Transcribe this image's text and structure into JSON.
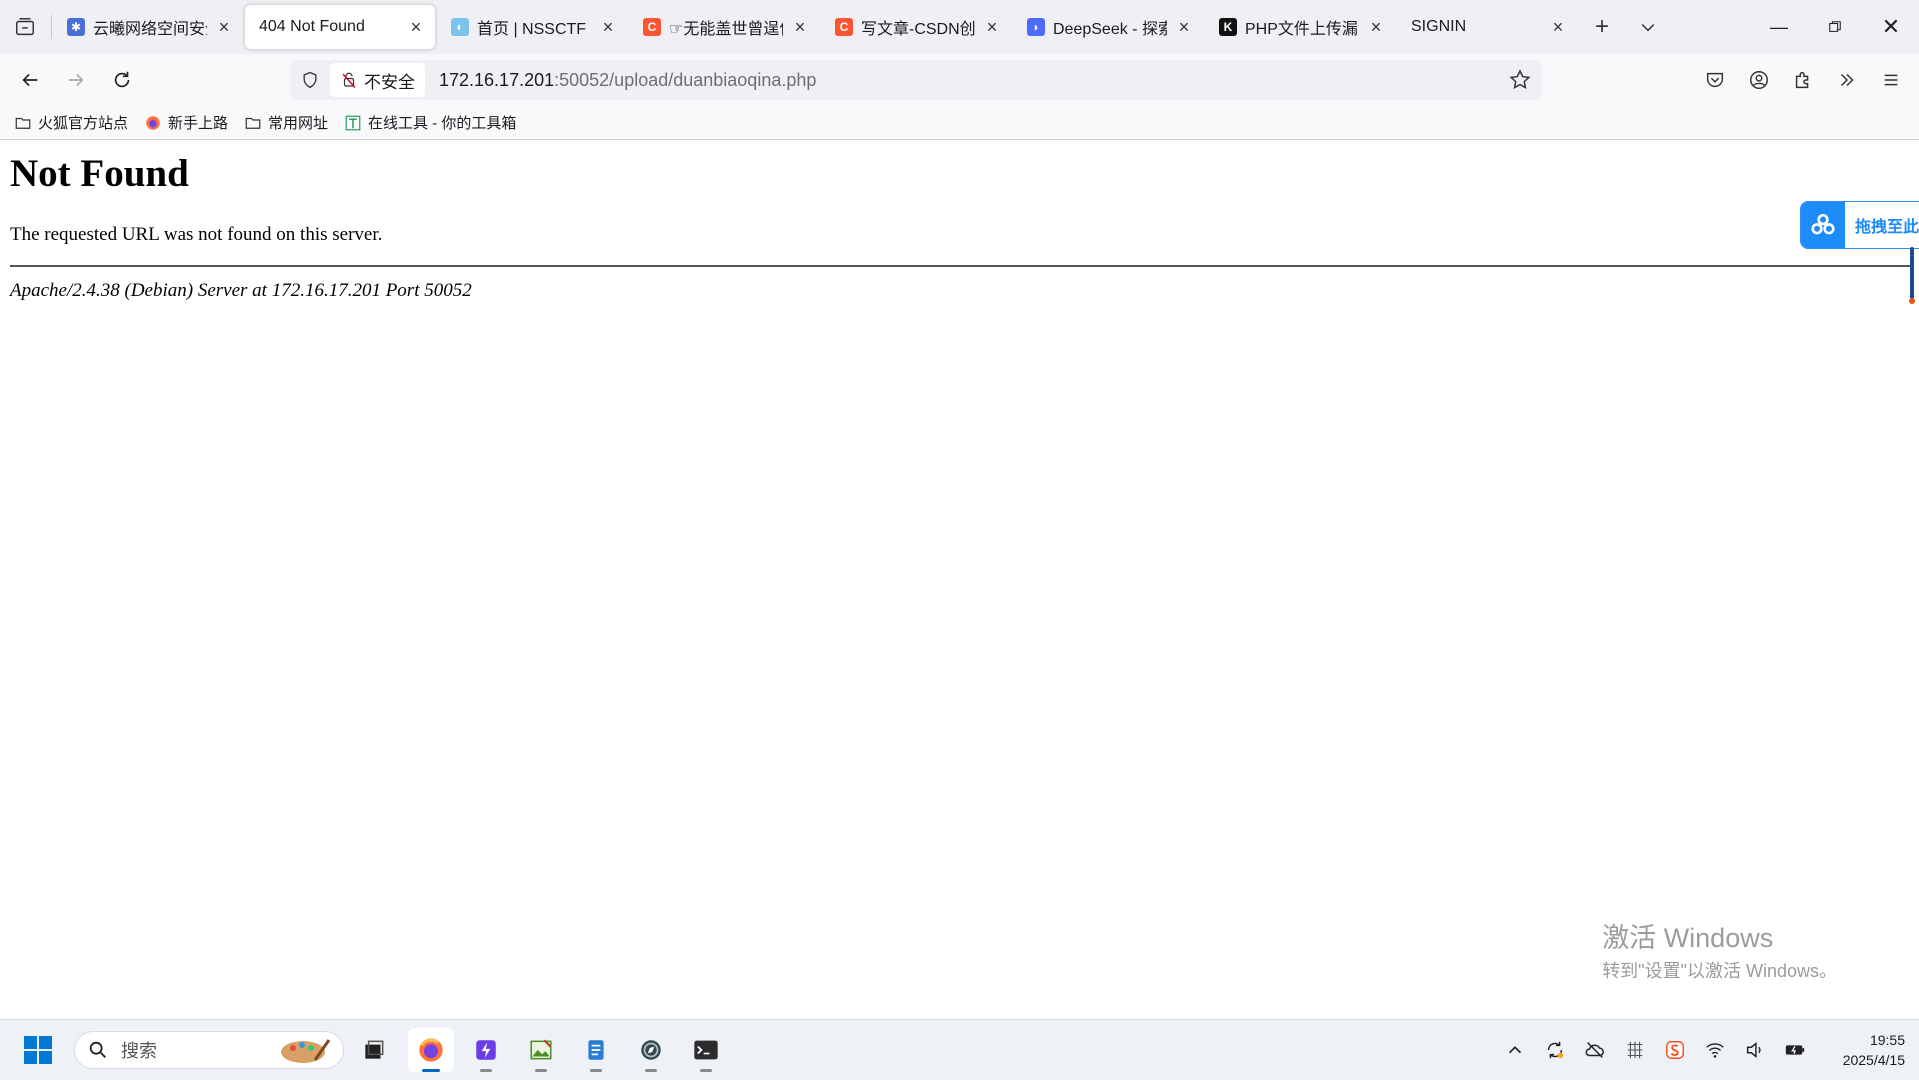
{
  "tabs": [
    {
      "title": "云曦网络空间安全",
      "favicon": "yunxi",
      "color": "#4a6fd8",
      "active": false
    },
    {
      "title": "404 Not Found",
      "favicon": "none",
      "color": "",
      "active": true
    },
    {
      "title": "首页 | NSSCTF",
      "favicon": "nssctf",
      "color": "#4ab0e8",
      "active": false
    },
    {
      "title": "☞无能盖世曾逞何",
      "favicon": "csdn",
      "color": "#fc5531",
      "active": false
    },
    {
      "title": "写文章-CSDN创作",
      "favicon": "csdn",
      "color": "#fc5531",
      "active": false
    },
    {
      "title": "DeepSeek - 探索",
      "favicon": "deepseek",
      "color": "#4d6bfe",
      "active": false
    },
    {
      "title": "PHP文件上传漏洞",
      "favicon": "k",
      "color": "#111111",
      "active": false
    },
    {
      "title": "SIGNIN",
      "favicon": "none",
      "color": "",
      "active": false
    }
  ],
  "address": {
    "security_label": "不安全",
    "url_host": "172.16.17.201",
    "url_rest": ":50052/upload/duanbiaoqina.php"
  },
  "bookmarks": [
    {
      "label": "火狐官方站点",
      "icon": "folder-icon"
    },
    {
      "label": "新手上路",
      "icon": "firefox-icon"
    },
    {
      "label": "常用网址",
      "icon": "folder-icon"
    },
    {
      "label": "在线工具 - 你的工具箱",
      "icon": "tool-icon"
    }
  ],
  "page": {
    "heading": "Not Found",
    "message": "The requested URL was not found on this server.",
    "server_info": "Apache/2.4.38 (Debian) Server at 172.16.17.201 Port 50052"
  },
  "widget": {
    "label": "拖拽至此"
  },
  "watermark": {
    "line1": "激活 Windows",
    "line2": "转到\"设置\"以激活 Windows。"
  },
  "taskbar": {
    "search_placeholder": "搜索",
    "time": "19:55",
    "date": "2025/4/15"
  }
}
